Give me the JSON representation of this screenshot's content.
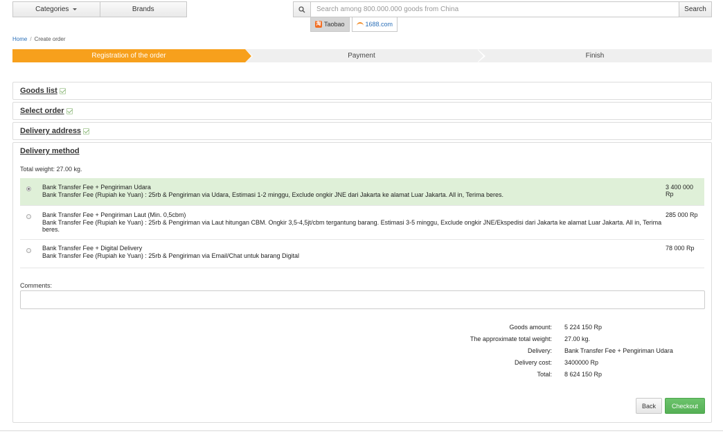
{
  "topnav": {
    "categories_label": "Categories",
    "brands_label": "Brands"
  },
  "search": {
    "placeholder": "Search among 800.000.000 goods from China",
    "button_label": "Search"
  },
  "sources": [
    {
      "label": "Taobao",
      "active": true
    },
    {
      "label": "1688.com",
      "active": false
    }
  ],
  "breadcrumb": {
    "home": "Home",
    "current": "Create order"
  },
  "steps": [
    "Registration of the order",
    "Payment",
    "Finish"
  ],
  "sections": {
    "goods_list": "Goods list",
    "select_order": "Select order",
    "delivery_address": "Delivery address",
    "delivery_method": "Delivery method"
  },
  "delivery": {
    "total_weight": "Total weight: 27.00 kg.",
    "options": [
      {
        "name": "Bank Transfer Fee + Pengiriman Udara",
        "description": "Bank Transfer Fee (Rupiah ke Yuan) : 25rb & Pengiriman via Udara, Estimasi 1-2 minggu, Exclude ongkir JNE dari Jakarta ke alamat Luar Jakarta. All in, Terima beres.",
        "price": "3 400 000 Rp",
        "selected": true
      },
      {
        "name": "Bank Transfer Fee + Pengiriman Laut (Min. 0,5cbm)",
        "description": "Bank Transfer Fee (Rupiah ke Yuan) : 25rb & Pengiriman via Laut hitungan CBM. Ongkir 3,5-4,5jt/cbm tergantung barang. Estimasi 3-5 minggu, Exclude ongkir JNE/Ekspedisi dari Jakarta ke alamat Luar Jakarta. All in, Terima beres.",
        "price": "285 000 Rp",
        "selected": false
      },
      {
        "name": "Bank Transfer Fee + Digital Delivery",
        "description": "Bank Transfer Fee (Rupiah ke Yuan) : 25rb & Pengiriman via Email/Chat untuk barang Digital",
        "price": "78 000 Rp",
        "selected": false
      }
    ],
    "comments_label": "Comments:",
    "comments_value": ""
  },
  "summary": [
    {
      "label": "Goods amount:",
      "value": "5 224 150 Rp"
    },
    {
      "label": "The approximate total weight:",
      "value": "27.00 kg."
    },
    {
      "label": "Delivery:",
      "value": "Bank Transfer Fee + Pengiriman Udara"
    },
    {
      "label": "Delivery cost:",
      "value": "3400000 Rp"
    },
    {
      "label": "Total:",
      "value": "8 624 150 Rp"
    }
  ],
  "actions": {
    "back_label": "Back",
    "checkout_label": "Checkout"
  },
  "colors": {
    "accent": "#f7a01c",
    "selected_row": "#dff0d8",
    "checkout": "#5cb85c",
    "link": "#2a6fb8"
  }
}
